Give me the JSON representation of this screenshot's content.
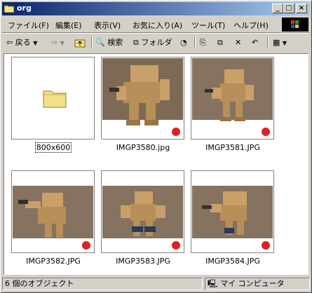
{
  "window": {
    "title": "org"
  },
  "menu": [
    "ファイル(F)",
    "編集(E)",
    "表示(V)",
    "お気に入り(A)",
    "ツール(T)",
    "ヘルプ(H)"
  ],
  "toolbar": {
    "back": "戻る",
    "search": "検索",
    "folders": "フォルダ"
  },
  "items": [
    {
      "name": "800x600",
      "type": "folder",
      "selected": true
    },
    {
      "name": "IMGP3580.jpg",
      "type": "image"
    },
    {
      "name": "IMGP3581.JPG",
      "type": "image"
    },
    {
      "name": "IMGP3582.JPG",
      "type": "image"
    },
    {
      "name": "IMGP3583.JPG",
      "type": "image"
    },
    {
      "name": "IMGP3584.JPG",
      "type": "image"
    }
  ],
  "status": {
    "count": "6 個のオブジェクト",
    "location": "マイ コンピュータ"
  },
  "colors": {
    "title_start": "#0a246a",
    "title_end": "#a6caf0",
    "window": "#d4d0c8",
    "folder": "#f3e08a",
    "stamp": "#e02020"
  }
}
